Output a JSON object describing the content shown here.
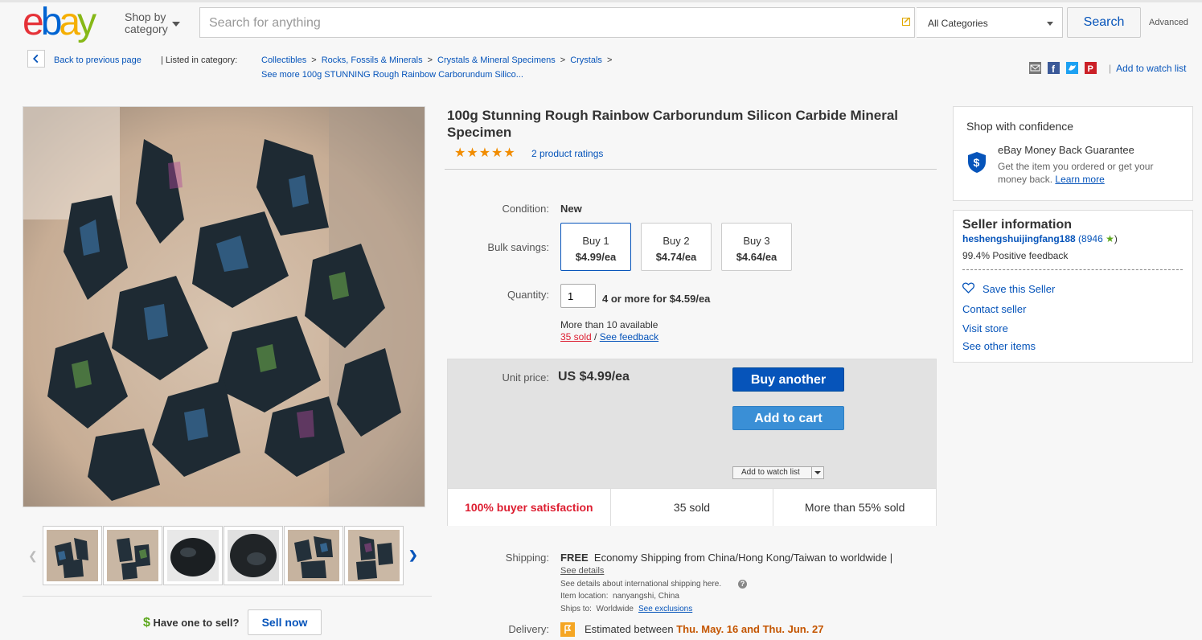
{
  "header": {
    "logo_text": "ebay",
    "shop_by_line1": "Shop by",
    "shop_by_line2": "category",
    "search_placeholder": "Search for anything",
    "category": "All Categories",
    "search_button": "Search",
    "advanced": "Advanced"
  },
  "breadcrumb": {
    "back": "Back to previous page",
    "listed_in": "| Listed in category:",
    "items": [
      "Collectibles",
      "Rocks, Fossils & Minerals",
      "Crystals & Mineral Specimens",
      "Crystals"
    ],
    "separator": ">",
    "more": "See more 100g STUNNING Rough Rainbow Carborundum Silico..."
  },
  "share": {
    "icons": [
      "email-icon",
      "facebook-icon",
      "twitter-icon",
      "pinterest-icon"
    ],
    "watch_list": "Add to watch list"
  },
  "product": {
    "title": "100g Stunning Rough Rainbow Carborundum Silicon Carbide Mineral Specimen",
    "stars": "★★★★★",
    "rating_value": 5,
    "ratings": "2 product ratings",
    "condition_label": "Condition:",
    "condition": "New",
    "bulk_label": "Bulk savings:",
    "bulk": [
      {
        "qty": "Buy 1",
        "price": "$4.99/ea",
        "selected": true
      },
      {
        "qty": "Buy 2",
        "price": "$4.74/ea",
        "selected": false
      },
      {
        "qty": "Buy 3",
        "price": "$4.64/ea",
        "selected": false
      }
    ],
    "quantity_label": "Quantity:",
    "quantity": "1",
    "quantity_offer": "4 or more for $4.59/ea",
    "available": "More than 10 available",
    "sold": "35 sold",
    "sold_sep": "/",
    "see_feedback": "See feedback"
  },
  "buybox": {
    "unit_label": "Unit price:",
    "unit_price": "US $4.99/ea",
    "buy_another": "Buy another",
    "add_to_cart": "Add to cart",
    "add_watch": "Add to watch list",
    "stats": [
      "100% buyer satisfaction",
      "35 sold",
      "More than 55% sold"
    ]
  },
  "shipping": {
    "label": "Shipping:",
    "free": "FREE",
    "method": "Economy Shipping from China/Hong Kong/Taiwan to worldwide |",
    "see_details": "See details",
    "intl": "See details about international shipping here.",
    "location_label": "Item location:",
    "location": "nanyangshi, China",
    "ships_label": "Ships to:",
    "ships_to": "Worldwide",
    "exclusions": "See exclusions",
    "delivery_label": "Delivery:",
    "delivery_pre": "Estimated between",
    "delivery_dates": "Thu. May. 16 and Thu. Jun. 27"
  },
  "gallery": {
    "thumbnail_count": 6
  },
  "sell": {
    "prompt": "Have one to sell?",
    "button": "Sell now"
  },
  "confidence": {
    "title": "Shop with confidence",
    "guarantee": "eBay Money Back Guarantee",
    "desc": "Get the item you ordered or get your money back.",
    "learn": "Learn more"
  },
  "seller": {
    "title": "Seller information",
    "name": "heshengshuijingfang188",
    "score": "(8946",
    "score_close": ")",
    "positive": "99.4% Positive feedback",
    "save": "Save this Seller",
    "contact": "Contact seller",
    "visit": "Visit store",
    "other": "See other items"
  },
  "colors": {
    "ebay_blue": "#0654ba",
    "buy_blue": "#0654ba",
    "cart_blue": "#3a8fd6",
    "red": "#dd1e31",
    "star_orange": "#f18c00",
    "green": "#5ba71b"
  }
}
